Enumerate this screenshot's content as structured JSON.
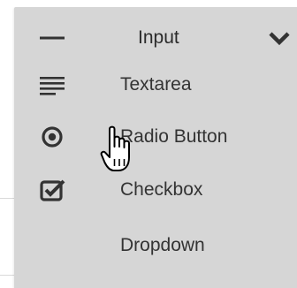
{
  "field_type_menu": {
    "items": [
      {
        "label": "Input",
        "icon": "horizontal-line-icon"
      },
      {
        "label": "Textarea",
        "icon": "text-lines-icon"
      },
      {
        "label": "Radio Button",
        "icon": "radio-icon"
      },
      {
        "label": "Checkbox",
        "icon": "checkbox-icon"
      },
      {
        "label": "Dropdown",
        "icon": ""
      }
    ],
    "chevron_icon": "chevron-down-icon",
    "panel_color": "#d6d6d6",
    "icon_color": "#333333"
  }
}
